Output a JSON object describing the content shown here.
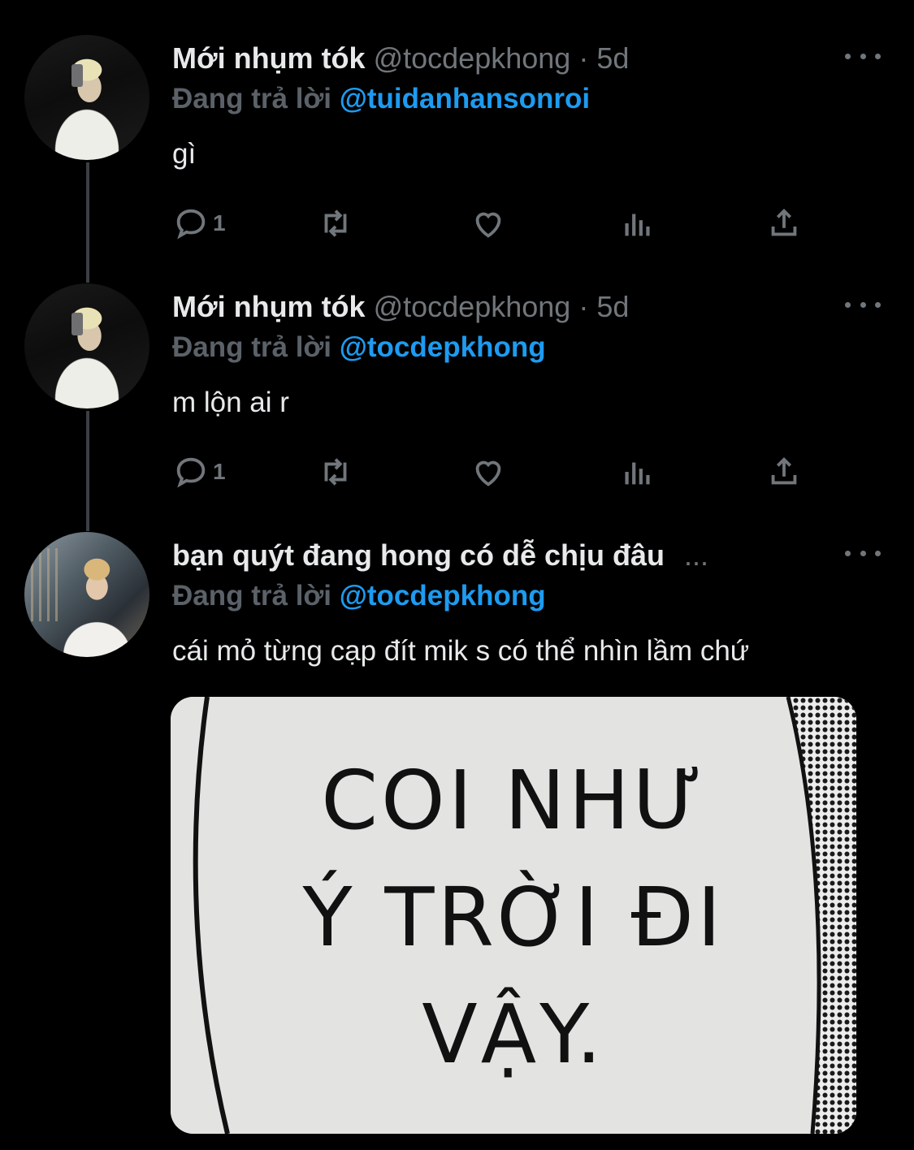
{
  "tweets": [
    {
      "name": "Mới nhụm tók",
      "handle": "@tocdepkhong",
      "separator": "·",
      "time": "5d",
      "reply_prefix": "Đang trả lời",
      "reply_to": "@tuidanhansonroi",
      "text": "gì",
      "reply_count": "1",
      "avatar": "blonde-selfie-avatar"
    },
    {
      "name": "Mới nhụm tók",
      "handle": "@tocdepkhong",
      "separator": "·",
      "time": "5d",
      "reply_prefix": "Đang trả lời",
      "reply_to": "@tocdepkhong",
      "text": "m lộn ai r",
      "reply_count": "1",
      "avatar": "blonde-selfie-avatar"
    },
    {
      "name": "bạn quýt đang hong có dễ chịu đâu",
      "name_ellipsis": "...",
      "reply_prefix": "Đang trả lời",
      "reply_to": "@tocdepkhong",
      "text": "cái mỏ từng cạp đít mik s có thể nhìn lầm chứ",
      "avatar": "bridge-portrait-avatar",
      "media": {
        "line1": "COI NHƯ",
        "line2": "Ý TRỜI ĐI",
        "line3": "VẬY."
      }
    }
  ],
  "icons": [
    "reply-icon",
    "retweet-icon",
    "like-icon",
    "views-icon",
    "share-icon",
    "more-icon"
  ],
  "colors": {
    "accent": "#1d9bf0",
    "muted": "#71767b",
    "background": "#000000"
  }
}
